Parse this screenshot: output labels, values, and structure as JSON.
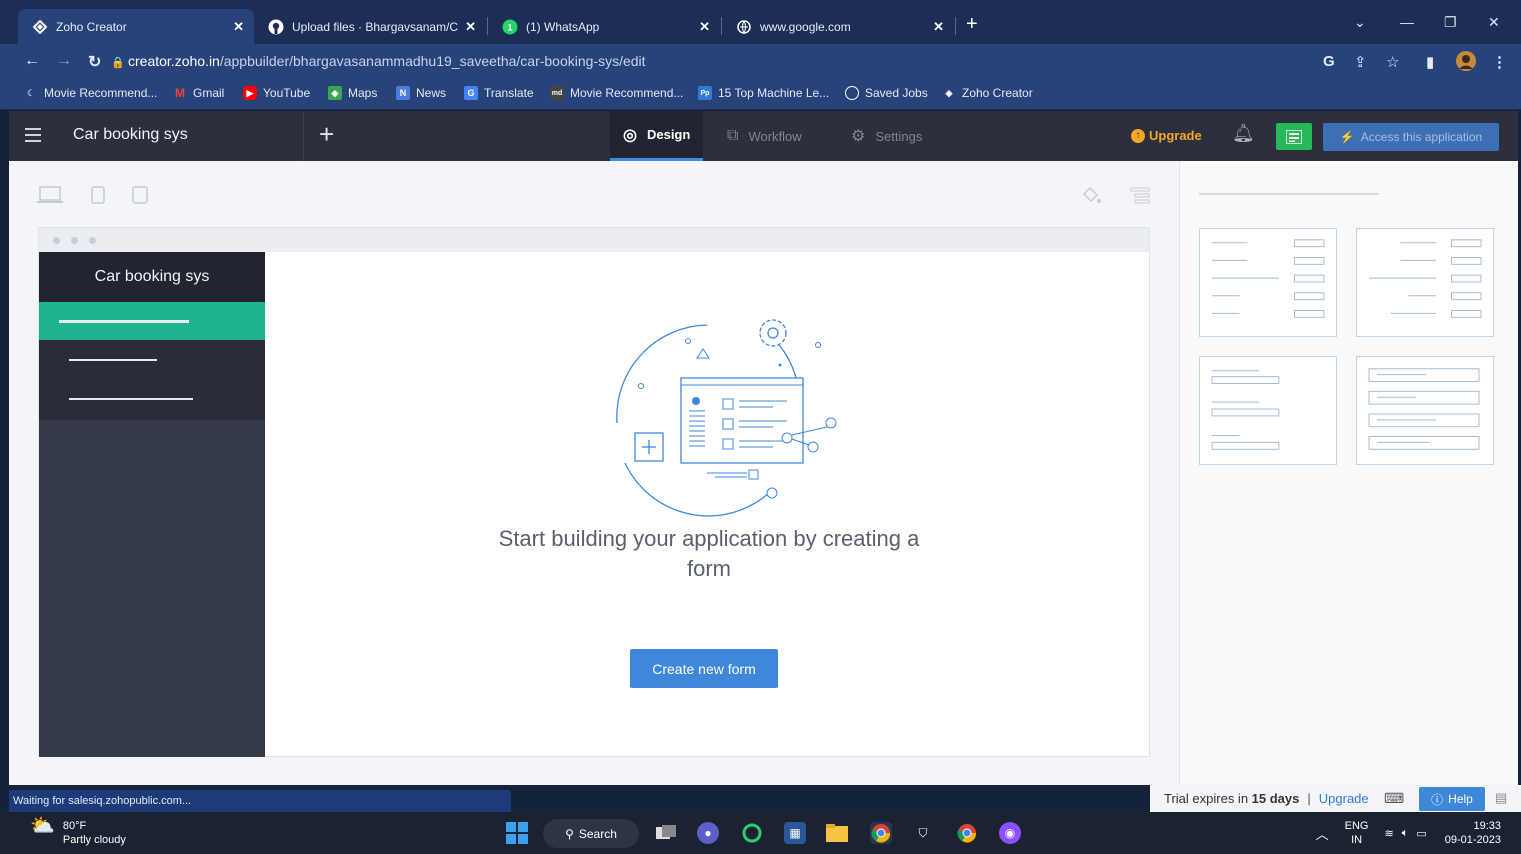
{
  "browser": {
    "tabs": [
      {
        "title": "Zoho Creator",
        "icon": "zoho-creator-icon"
      },
      {
        "title": "Upload files · Bhargavsanam/CSA",
        "icon": "github-icon"
      },
      {
        "title": "(1) WhatsApp",
        "icon": "whatsapp-icon"
      },
      {
        "title": "www.google.com",
        "icon": "globe-icon"
      }
    ],
    "url_host": "creator.zoho.in",
    "url_path": "/appbuilder/bhargavasanammadhu19_saveetha/car-booking-sys/edit",
    "bookmarks": [
      {
        "label": "Movie Recommend..."
      },
      {
        "label": "Gmail"
      },
      {
        "label": "YouTube"
      },
      {
        "label": "Maps"
      },
      {
        "label": "News"
      },
      {
        "label": "Translate"
      },
      {
        "label": "Movie Recommend..."
      },
      {
        "label": "15 Top Machine Le..."
      },
      {
        "label": "Saved Jobs"
      },
      {
        "label": "Zoho Creator"
      }
    ]
  },
  "app": {
    "title": "Car booking sys",
    "tabs": [
      {
        "label": "Design",
        "icon": "palette-icon"
      },
      {
        "label": "Workflow",
        "icon": "workflow-icon"
      },
      {
        "label": "Settings",
        "icon": "gear-icon"
      }
    ],
    "upgrade_label": "Upgrade",
    "access_label": "Access this application"
  },
  "canvas": {
    "nav_title": "Car booking sys",
    "empty_message": "Start building your application by creating a form",
    "create_button": "Create new form"
  },
  "status": {
    "loading": "Waiting for salesiq.zohopublic.com...",
    "trial_prefix": "Trial expires in",
    "trial_days": "15 days",
    "upgrade_link": "Upgrade",
    "help_label": "Help"
  },
  "taskbar": {
    "temperature": "80°F",
    "weather": "Partly cloudy",
    "search_label": "Search",
    "lang_top": "ENG",
    "lang_bottom": "IN",
    "time": "19:33",
    "date": "09-01-2023"
  },
  "colors": {
    "accent_blue": "#3f87d8",
    "nav_active": "#1fb38f",
    "upgrade_orange": "#f5a623"
  }
}
